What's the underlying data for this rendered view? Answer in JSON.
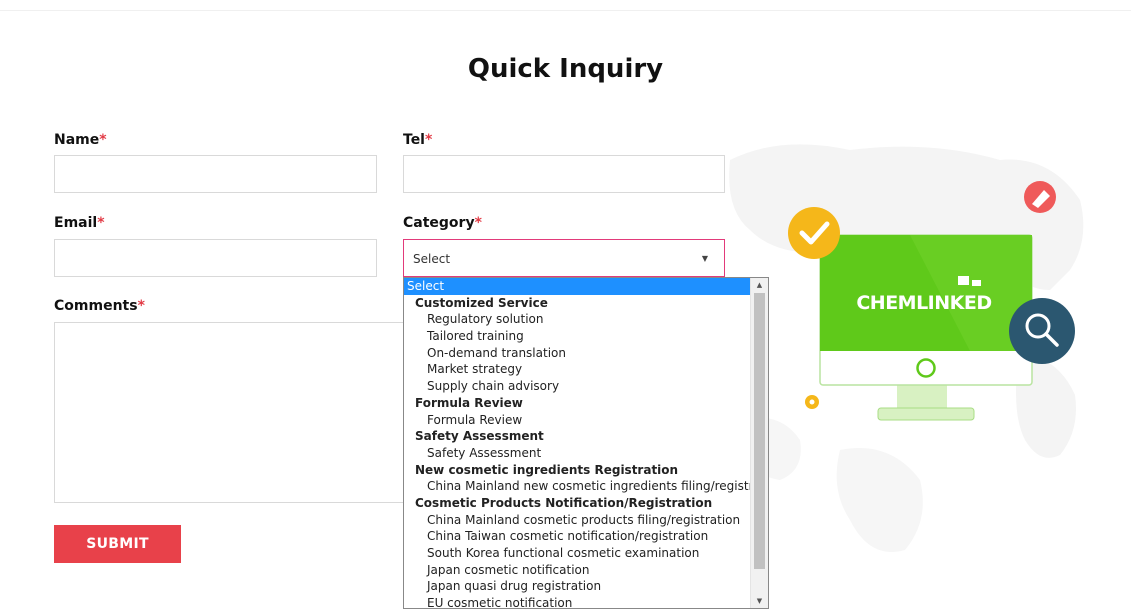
{
  "page": {
    "title": "Quick Inquiry"
  },
  "form": {
    "name_label": "Name",
    "tel_label": "Tel",
    "email_label": "Email",
    "category_label": "Category",
    "comments_label": "Comments",
    "required_mark": "*",
    "category_value": "Select",
    "submit_label": "SUBMIT"
  },
  "dropdown": {
    "selected": "Select",
    "items": [
      {
        "kind": "selected",
        "label": "Select"
      },
      {
        "kind": "group",
        "label": "Customized Service"
      },
      {
        "kind": "opt",
        "label": "Regulatory solution"
      },
      {
        "kind": "opt",
        "label": "Tailored training"
      },
      {
        "kind": "opt",
        "label": "On-demand translation"
      },
      {
        "kind": "opt",
        "label": "Market strategy"
      },
      {
        "kind": "opt",
        "label": "Supply chain advisory"
      },
      {
        "kind": "group",
        "label": "Formula Review"
      },
      {
        "kind": "opt",
        "label": "Formula Review"
      },
      {
        "kind": "group",
        "label": "Safety Assessment"
      },
      {
        "kind": "opt",
        "label": "Safety Assessment"
      },
      {
        "kind": "group",
        "label": "New cosmetic ingredients Registration"
      },
      {
        "kind": "opt",
        "label": "China Mainland new cosmetic ingredients filing/registration"
      },
      {
        "kind": "group",
        "label": "Cosmetic Products Notification/Registration"
      },
      {
        "kind": "opt",
        "label": "China Mainland cosmetic products filing/registration"
      },
      {
        "kind": "opt",
        "label": "China Taiwan cosmetic notification/registration"
      },
      {
        "kind": "opt",
        "label": "South Korea functional cosmetic examination"
      },
      {
        "kind": "opt",
        "label": "Japan cosmetic notification"
      },
      {
        "kind": "opt",
        "label": "Japan quasi drug registration"
      },
      {
        "kind": "opt",
        "label": "EU cosmetic notification"
      }
    ]
  },
  "illustration": {
    "brand_text": "CHEMLINKED",
    "colors": {
      "screen": "#5fc91a",
      "check_badge": "#f5b71a",
      "search_badge": "#2b5770",
      "tag_badge": "#ef5a5a"
    },
    "icons": [
      "check-icon",
      "search-icon",
      "tag-icon"
    ]
  }
}
